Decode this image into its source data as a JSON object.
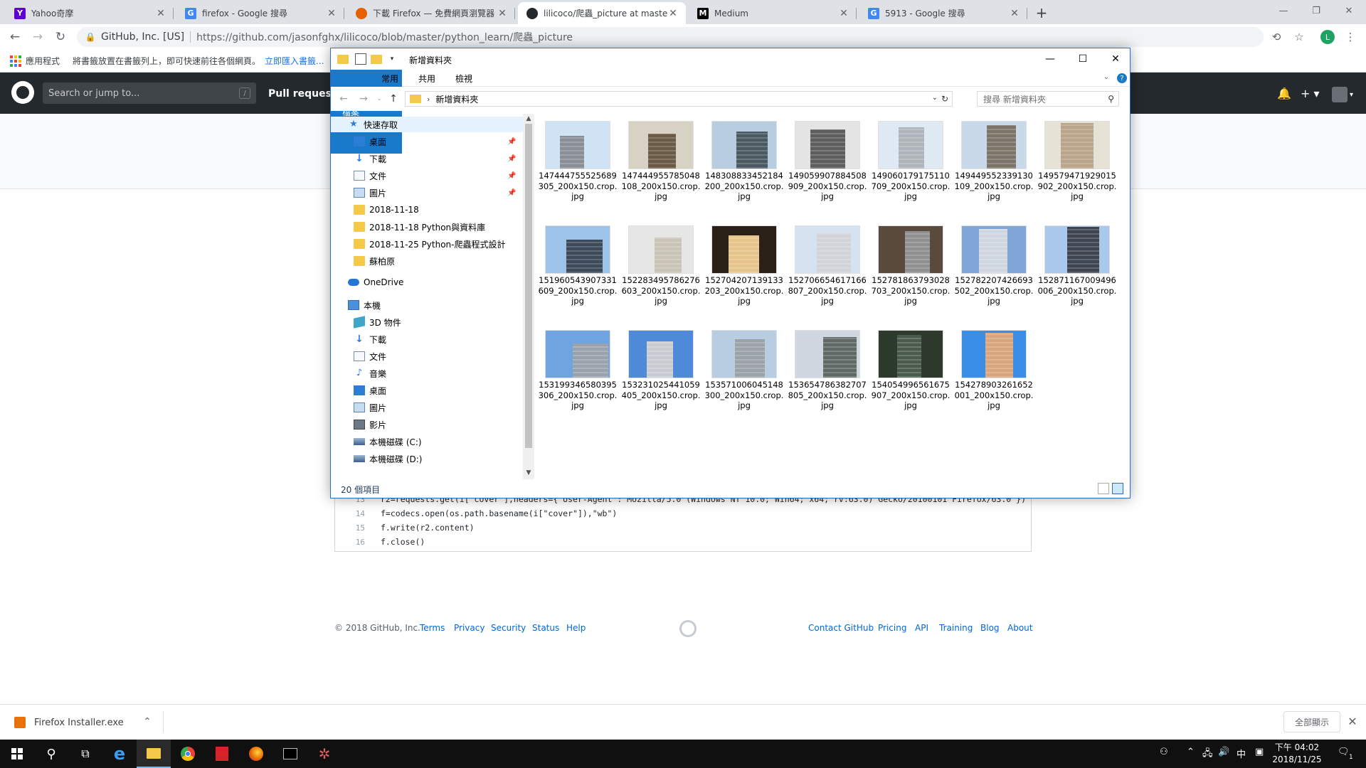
{
  "browser": {
    "tabs": [
      {
        "label": "Yahoo奇摩",
        "favicon": "yahoo-icon",
        "active": false
      },
      {
        "label": "firefox - Google 搜尋",
        "favicon": "google-icon",
        "active": false
      },
      {
        "label": "下載 Firefox — 免費網頁瀏覽器",
        "favicon": "firefox-icon",
        "active": false
      },
      {
        "label": "lilicoco/爬蟲_picture at master",
        "favicon": "github-icon",
        "active": true
      },
      {
        "label": "Medium",
        "favicon": "medium-icon",
        "active": false
      },
      {
        "label": "5913 - Google 搜尋",
        "favicon": "google-icon",
        "active": false
      }
    ],
    "new_tab": "+",
    "address": {
      "org": "GitHub, Inc. [US]",
      "url": "https://github.com/jasonfghx/lilicoco/blob/master/python_learn/爬蟲_picture"
    },
    "profile_initial": "L",
    "bookmarks": {
      "apps": "應用程式",
      "hint": "將書籤放置在書籤列上，即可快速前往各個網頁。",
      "import": "立即匯入書籤..."
    }
  },
  "github": {
    "search_placeholder": "Search or jump to...",
    "search_key": "/",
    "pull_requests": "Pull requests",
    "code_lines": [
      {
        "num": "13",
        "code": "r2=requests.get(i[\"cover\"],headers={\"User-Agent\":\"Mozilla/5.0 (Windows NT 10.0; Win64; x64; rv:63.0) Gecko/20100101 Firefox/63.0\"})"
      },
      {
        "num": "14",
        "code": "f=codecs.open(os.path.basename(i[\"cover\"]),\"wb\")"
      },
      {
        "num": "15",
        "code": "f.write(r2.content)"
      },
      {
        "num": "16",
        "code": "f.close()"
      }
    ],
    "footer": {
      "copyright": "© 2018 GitHub, Inc.",
      "left_links": [
        "Terms",
        "Privacy",
        "Security",
        "Status",
        "Help"
      ],
      "right_links": [
        "Contact GitHub",
        "Pricing",
        "API",
        "Training",
        "Blog",
        "About"
      ]
    }
  },
  "explorer": {
    "title": "新增資料夾",
    "ribbon_tabs": [
      "檔案",
      "常用",
      "共用",
      "檢視"
    ],
    "path": "新增資料夾",
    "search_placeholder": "搜尋 新增資料夾",
    "nav": [
      {
        "label": "快速存取",
        "icon": "star-icon",
        "level": 0,
        "pinned": false,
        "selected": true
      },
      {
        "label": "桌面",
        "icon": "desktop-icon",
        "level": 1,
        "pinned": true
      },
      {
        "label": "下載",
        "icon": "download-icon",
        "level": 1,
        "pinned": true
      },
      {
        "label": "文件",
        "icon": "documents-icon",
        "level": 1,
        "pinned": true
      },
      {
        "label": "圖片",
        "icon": "pictures-icon",
        "level": 1,
        "pinned": true
      },
      {
        "label": "2018-11-18",
        "icon": "folder-icon",
        "level": 1,
        "pinned": false
      },
      {
        "label": "2018-11-18 Python與資料庫",
        "icon": "folder-icon",
        "level": 1,
        "pinned": false
      },
      {
        "label": "2018-11-25 Python-爬蟲程式設計",
        "icon": "folder-icon",
        "level": 1,
        "pinned": false
      },
      {
        "label": "蘇柏原",
        "icon": "folder-icon",
        "level": 1,
        "pinned": false
      },
      {
        "label": "OneDrive",
        "icon": "onedrive-icon",
        "level": 0,
        "pinned": false
      },
      {
        "label": "本機",
        "icon": "this-pc-icon",
        "level": 0,
        "pinned": false
      },
      {
        "label": "3D 物件",
        "icon": "3d-objects-icon",
        "level": 1,
        "pinned": false
      },
      {
        "label": "下載",
        "icon": "download-icon",
        "level": 1,
        "pinned": false
      },
      {
        "label": "文件",
        "icon": "documents-icon",
        "level": 1,
        "pinned": false
      },
      {
        "label": "音樂",
        "icon": "music-icon",
        "level": 1,
        "pinned": false
      },
      {
        "label": "桌面",
        "icon": "desktop-icon",
        "level": 1,
        "pinned": false
      },
      {
        "label": "圖片",
        "icon": "pictures-icon",
        "level": 1,
        "pinned": false
      },
      {
        "label": "影片",
        "icon": "videos-icon",
        "level": 1,
        "pinned": false
      },
      {
        "label": "本機磁碟 (C:)",
        "icon": "drive-icon",
        "level": 1,
        "pinned": false
      },
      {
        "label": "本機磁碟 (D:)",
        "icon": "drive-icon",
        "level": 1,
        "pinned": false
      }
    ],
    "files": [
      {
        "name": "147444755525689305_200x150.crop.jpg"
      },
      {
        "name": "147444955785048108_200x150.crop.jpg"
      },
      {
        "name": "148308833452184200_200x150.crop.jpg"
      },
      {
        "name": "149059907884508909_200x150.crop.jpg"
      },
      {
        "name": "149060179175110709_200x150.crop.jpg"
      },
      {
        "name": "149449552339130109_200x150.crop.jpg"
      },
      {
        "name": "149579471929015902_200x150.crop.jpg"
      },
      {
        "name": "151960543907331609_200x150.crop.jpg"
      },
      {
        "name": "152283495786276603_200x150.crop.jpg"
      },
      {
        "name": "152704207139133203_200x150.crop.jpg"
      },
      {
        "name": "152706654617166807_200x150.crop.jpg"
      },
      {
        "name": "152781863793028703_200x150.crop.jpg"
      },
      {
        "name": "152782207426693502_200x150.crop.jpg"
      },
      {
        "name": "152871167009496006_200x150.crop.jpg"
      },
      {
        "name": "153199346580395306_200x150.crop.jpg"
      },
      {
        "name": "153231025441059405_200x150.crop.jpg"
      },
      {
        "name": "153571006045148300_200x150.crop.jpg"
      },
      {
        "name": "153654786382707805_200x150.crop.jpg"
      },
      {
        "name": "154054996561675907_200x150.crop.jpg"
      },
      {
        "name": "154278903261652001_200x150.crop.jpg"
      }
    ],
    "status": "20 個項目"
  },
  "downloads": {
    "file": "Firefox Installer.exe",
    "show_all": "全部顯示"
  },
  "taskbar": {
    "ime": "中",
    "time": "下午 04:02",
    "date": "2018/11/25",
    "notifications": "1"
  },
  "colors": {
    "accent": "#1979ca",
    "github_header": "#24292e",
    "link": "#0366d6"
  }
}
